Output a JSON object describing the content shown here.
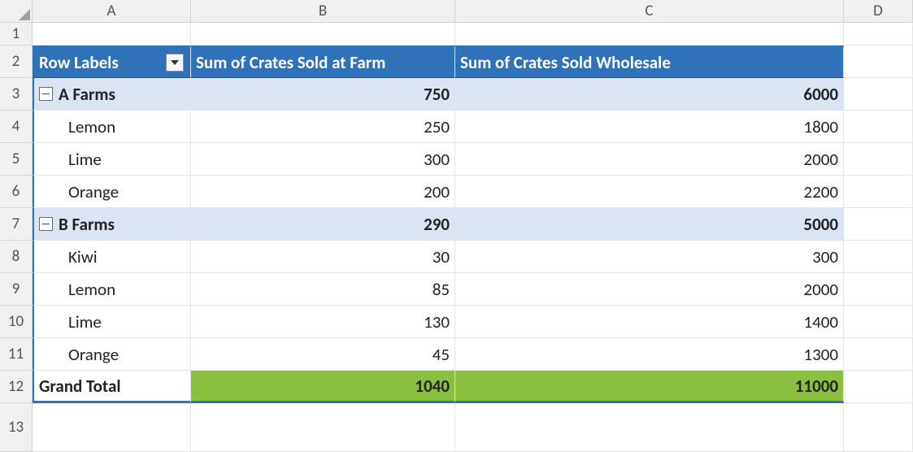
{
  "columns": [
    "A",
    "B",
    "C",
    "D"
  ],
  "row_numbers": [
    "1",
    "2",
    "3",
    "4",
    "5",
    "6",
    "7",
    "8",
    "9",
    "10",
    "11",
    "12",
    "13"
  ],
  "pivot": {
    "header": {
      "row_labels": "Row Labels",
      "col1": "Sum of Crates Sold at Farm",
      "col2": "Sum of Crates Sold Wholesale"
    },
    "groups": [
      {
        "name": "A Farms",
        "sum_farm": "750",
        "sum_wholesale": "6000",
        "items": [
          {
            "name": "Lemon",
            "farm": "250",
            "wholesale": "1800"
          },
          {
            "name": "Lime",
            "farm": "300",
            "wholesale": "2000"
          },
          {
            "name": "Orange",
            "farm": "200",
            "wholesale": "2200"
          }
        ]
      },
      {
        "name": "B Farms",
        "sum_farm": "290",
        "sum_wholesale": "5000",
        "items": [
          {
            "name": "Kiwi",
            "farm": "30",
            "wholesale": "300"
          },
          {
            "name": "Lemon",
            "farm": "85",
            "wholesale": "2000"
          },
          {
            "name": "Lime",
            "farm": "130",
            "wholesale": "1400"
          },
          {
            "name": "Orange",
            "farm": "45",
            "wholesale": "1300"
          }
        ]
      }
    ],
    "grand_total": {
      "label": "Grand Total",
      "farm": "1040",
      "wholesale": "11000"
    }
  }
}
